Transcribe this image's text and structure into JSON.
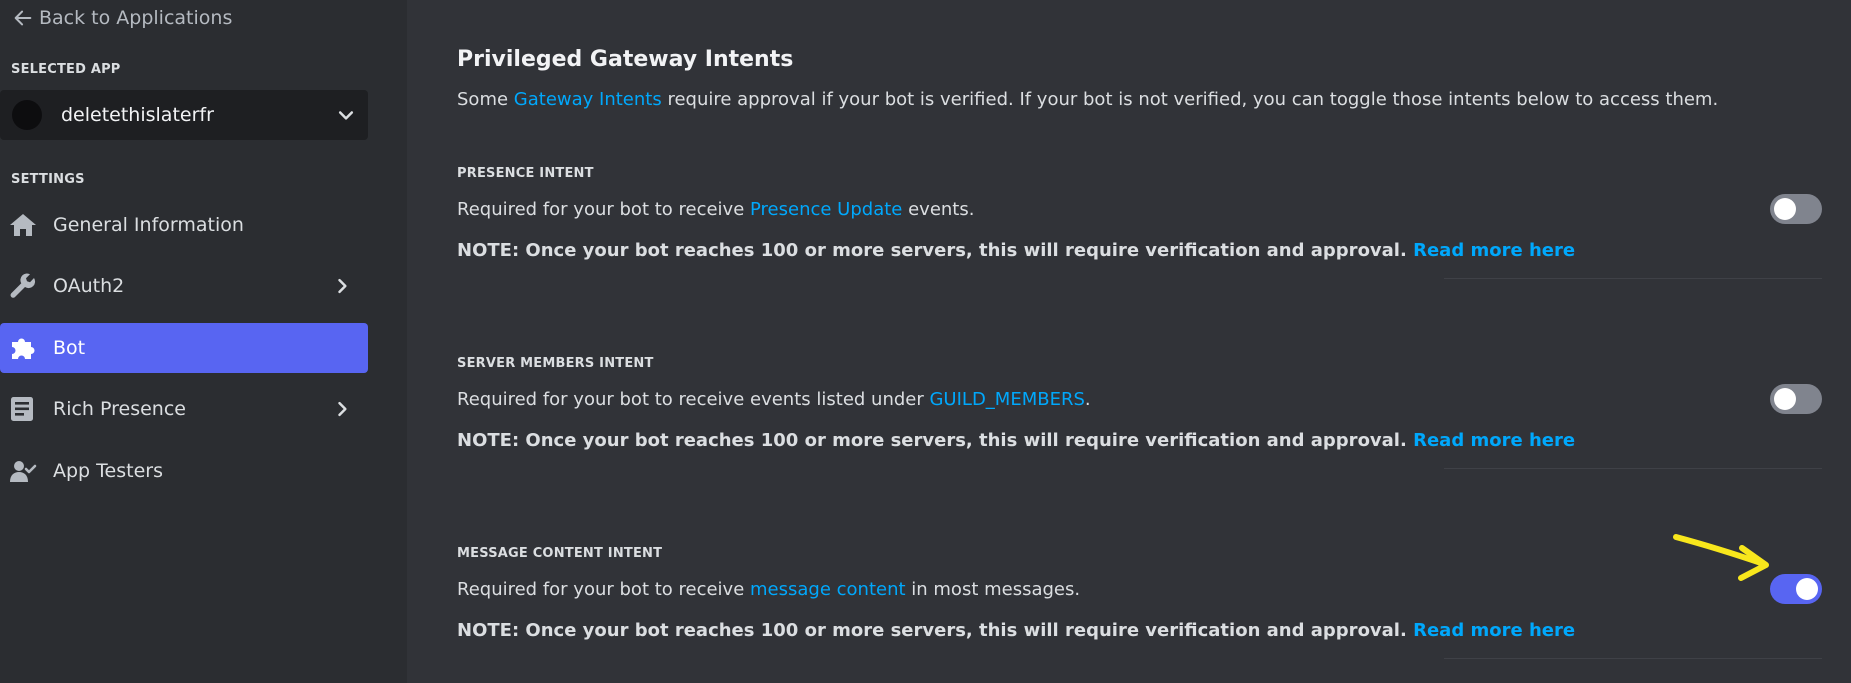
{
  "sidebar": {
    "back_link": "Back to Applications",
    "selected_app_label": "SELECTED APP",
    "app_name": "deletethislaterfr",
    "settings_label": "SETTINGS",
    "items": [
      {
        "label": "General Information",
        "icon": "home-icon",
        "has_chevron": false,
        "active": false
      },
      {
        "label": "OAuth2",
        "icon": "wrench-icon",
        "has_chevron": true,
        "active": false
      },
      {
        "label": "Bot",
        "icon": "puzzle-icon",
        "has_chevron": false,
        "active": true
      },
      {
        "label": "Rich Presence",
        "icon": "document-icon",
        "has_chevron": true,
        "active": false
      },
      {
        "label": "App Testers",
        "icon": "user-check-icon",
        "has_chevron": false,
        "active": false
      }
    ]
  },
  "main": {
    "title": "Privileged Gateway Intents",
    "desc_pre": "Some ",
    "desc_link": "Gateway Intents",
    "desc_post": " require approval if your bot is verified. If your bot is not verified, you can toggle those intents below to access them.",
    "intents": [
      {
        "heading": "PRESENCE INTENT",
        "desc_pre": "Required for your bot to receive ",
        "desc_link": "Presence Update",
        "desc_post": " events.",
        "note": "NOTE: Once your bot reaches 100 or more servers, this will require verification and approval.",
        "note_link": "Read more here",
        "enabled": false
      },
      {
        "heading": "SERVER MEMBERS INTENT",
        "desc_pre": "Required for your bot to receive events listed under ",
        "desc_link": "GUILD_MEMBERS",
        "desc_post": ".",
        "note": "NOTE: Once your bot reaches 100 or more servers, this will require verification and approval.",
        "note_link": "Read more here",
        "enabled": false
      },
      {
        "heading": "MESSAGE CONTENT INTENT",
        "desc_pre": "Required for your bot to receive ",
        "desc_link": "message content",
        "desc_post": " in most messages.",
        "note": "NOTE: Once your bot reaches 100 or more servers, this will require verification and approval.",
        "note_link": "Read more here",
        "enabled": true
      }
    ]
  },
  "colors": {
    "accent": "#5865f2",
    "link": "#00a8fc",
    "annotation": "#f8e71c"
  }
}
